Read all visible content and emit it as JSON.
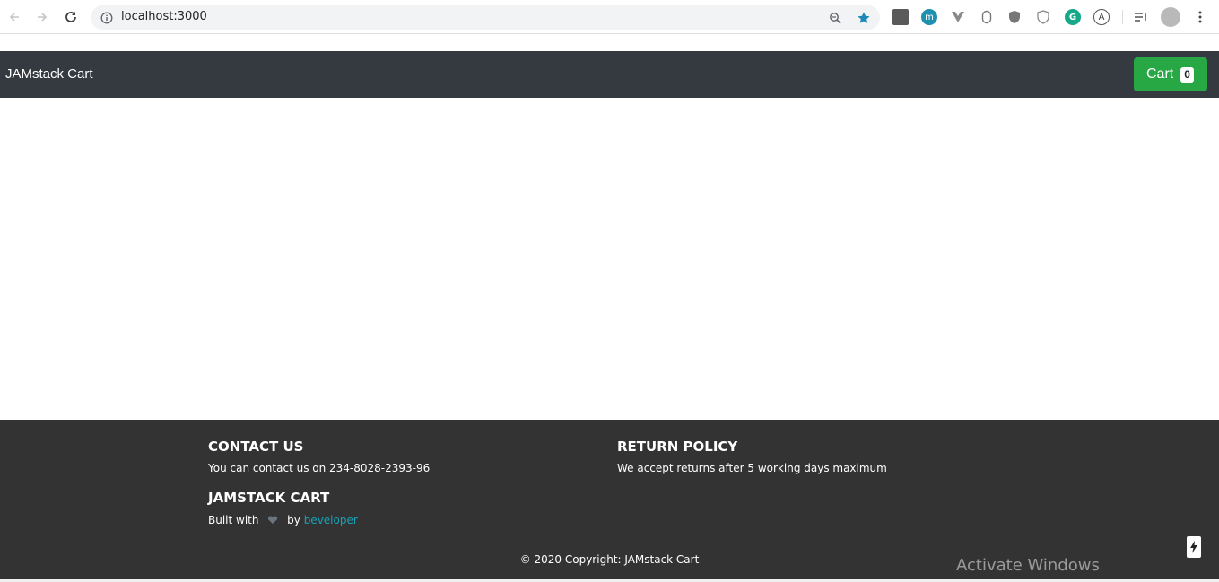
{
  "browser": {
    "url": "localhost:3000"
  },
  "navbar": {
    "brand": "JAMstack Cart",
    "cart_label": "Cart",
    "cart_count": "0"
  },
  "footer": {
    "contact_heading": "CONTACT US",
    "contact_text": "You can contact us on 234-8028-2393-96",
    "brand_heading": "JAMSTACK CART",
    "built_with": "Built with",
    "by": "by",
    "author_link": "beveloper",
    "return_heading": "RETURN POLICY",
    "return_text": "We accept returns after 5 working days maximum",
    "copyright": "© 2020 Copyright: JAMstack Cart"
  },
  "watermark": "Activate Windows",
  "colors": {
    "navbar": "#343a40",
    "footer": "#333333",
    "cart_button": "#28a745",
    "link": "#17a2b8"
  }
}
